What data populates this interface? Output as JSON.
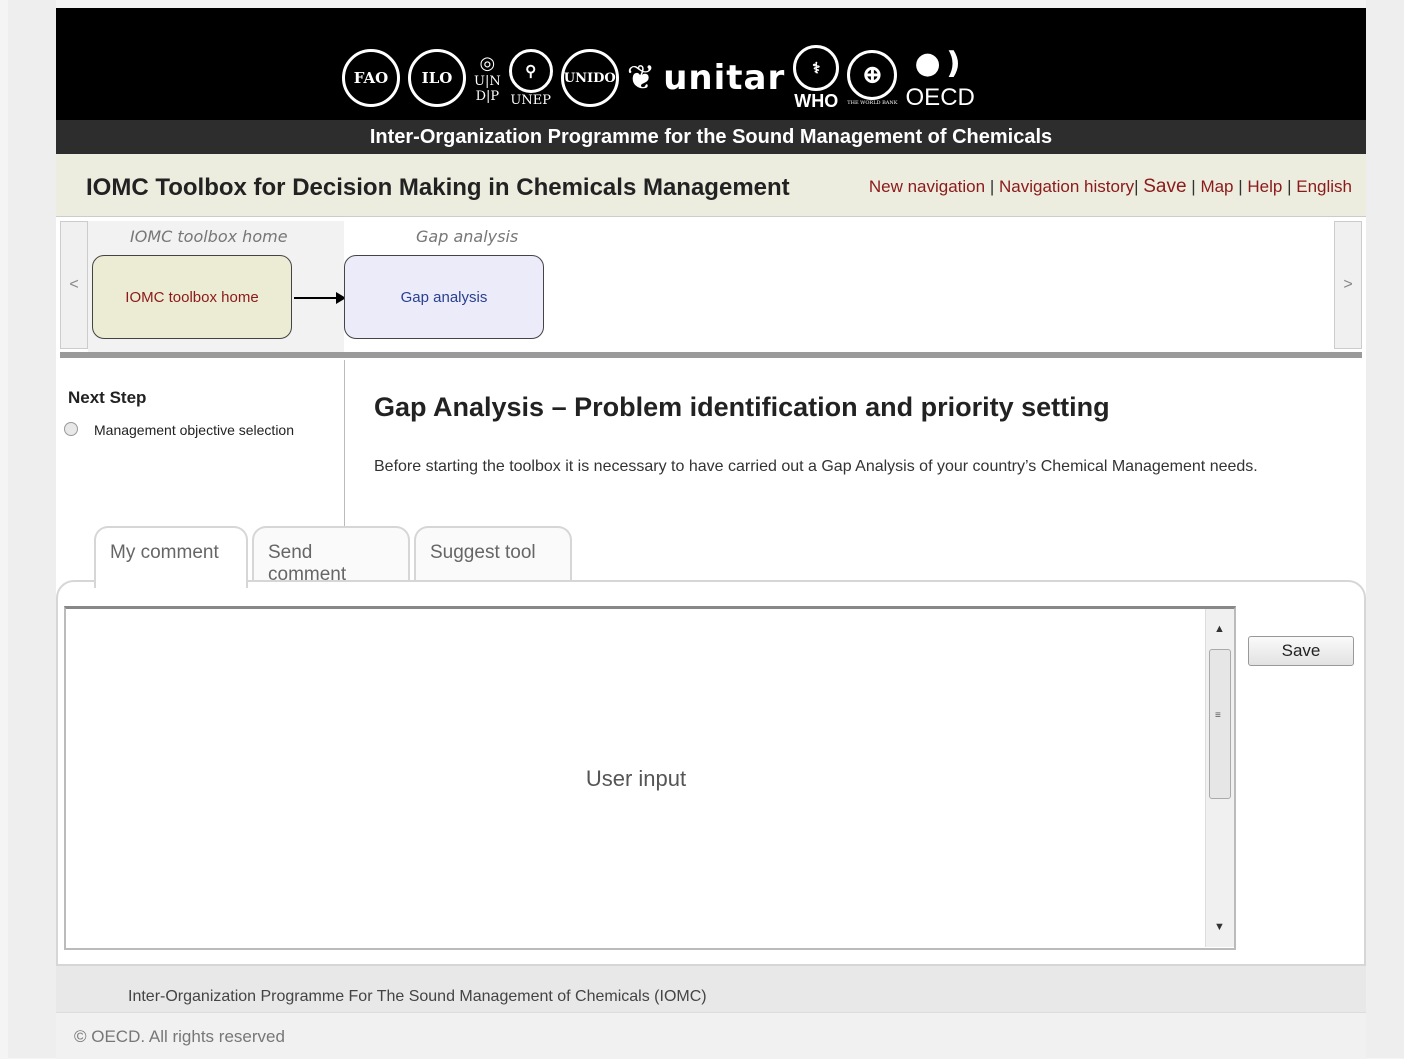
{
  "banner": {
    "logos": [
      "FAO",
      "ILO",
      "UNDP",
      "UNEP",
      "UNIDO",
      "UNITAR",
      "unitar",
      "WHO",
      "THE WORLD BANK",
      "OECD"
    ],
    "fao": "FAO",
    "ilo": "ILO",
    "undp_top": "U|N",
    "undp_bottom": "D|P",
    "unep": "UNEP",
    "unido": "UNIDO",
    "unitar": "unitar",
    "who": "WHO",
    "worldbank": "THE WORLD BANK",
    "oecd": "OECD",
    "subtitle": "Inter-Organization Programme for the Sound Management of Chemicals"
  },
  "header": {
    "title": "IOMC Toolbox for Decision Making in Chemicals Management",
    "nav": {
      "new_navigation": "New navigation",
      "navigation_history": "Navigation history",
      "save": "Save",
      "map": "Map",
      "help": "Help",
      "language": "English"
    }
  },
  "flow": {
    "prev_arrow": "<",
    "next_arrow": ">",
    "column_labels": [
      "IOMC toolbox home",
      "Gap analysis"
    ],
    "nodes": [
      "IOMC toolbox home",
      "Gap analysis"
    ]
  },
  "sidebar": {
    "title": "Next Step",
    "options": [
      "Management objective selection"
    ]
  },
  "main": {
    "title": "Gap Analysis – Problem identification and priority setting",
    "description": "Before starting the toolbox it is necessary to have carried out a Gap Analysis of your country’s Chemical Management needs."
  },
  "tabs": [
    "My comment",
    "Send comment",
    "Suggest tool"
  ],
  "comment": {
    "placeholder": "User input",
    "save_label": "Save"
  },
  "footer": {
    "org": "Inter-Organization Programme For The Sound Management of Chemicals (IOMC)",
    "copyright": "© OECD. All rights reserved"
  }
}
